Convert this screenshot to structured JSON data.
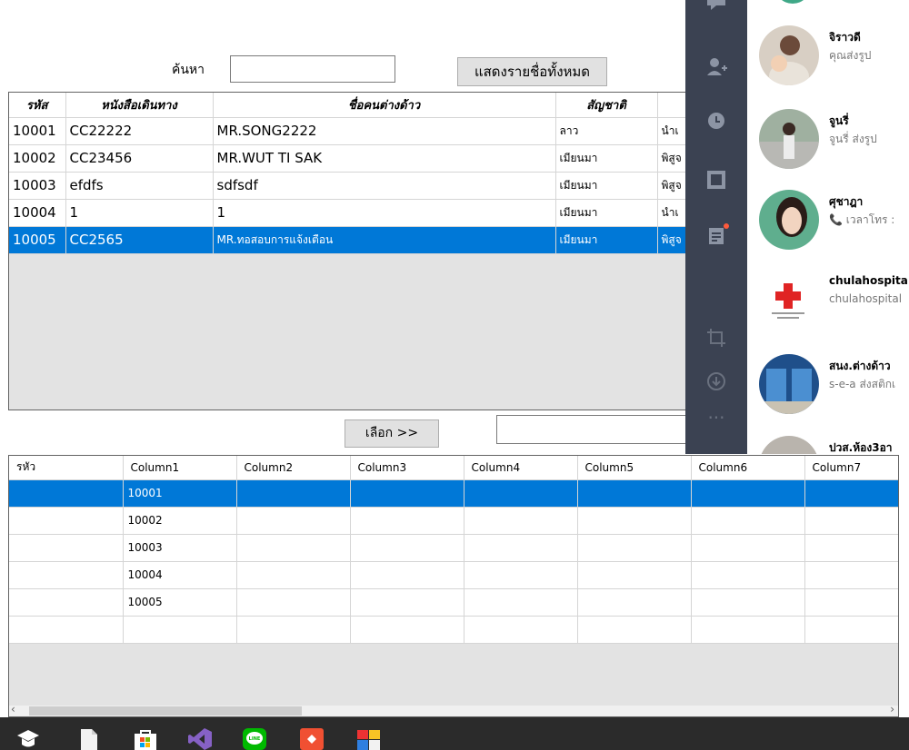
{
  "search": {
    "label": "ค้นหา",
    "value": "",
    "show_all_label": "แสดงรายชื่อทั้งหมด"
  },
  "grid1": {
    "headers": [
      "รหัส",
      "หนังสือเดินทาง",
      "ชื่อคนต่างด้าว",
      "สัญชาติ",
      ""
    ],
    "rows": [
      [
        "10001",
        "CC22222",
        "MR.SONG2222",
        "ลาว",
        "นำเ"
      ],
      [
        "10002",
        "CC23456",
        "MR.WUT TI SAK",
        "เมียนมา",
        "พิสูจ"
      ],
      [
        "10003",
        "efdfs",
        "sdfsdf",
        "เมียนมา",
        "พิสูจ"
      ],
      [
        "10004",
        "1",
        "1",
        "เมียนมา",
        "นำเ"
      ],
      [
        "10005",
        "CC2565",
        "MR.ทอสอบการแจ้งเตือน",
        "เมียนมา",
        "พิสูจ"
      ]
    ],
    "selected_row": 4
  },
  "select_button_label": "เลือก >>",
  "aux_input_value": "",
  "grid2": {
    "headers": [
      "รหัว",
      "Column1",
      "Column2",
      "Column3",
      "Column4",
      "Column5",
      "Column6",
      "Column7"
    ],
    "rows": [
      [
        "",
        "10001",
        "",
        "",
        "",
        "",
        "",
        ""
      ],
      [
        "",
        "10002",
        "",
        "",
        "",
        "",
        "",
        ""
      ],
      [
        "",
        "10003",
        "",
        "",
        "",
        "",
        "",
        ""
      ],
      [
        "",
        "10004",
        "",
        "",
        "",
        "",
        "",
        ""
      ],
      [
        "",
        "10005",
        "",
        "",
        "",
        "",
        "",
        ""
      ],
      [
        "",
        "",
        "",
        "",
        "",
        "",
        "",
        ""
      ]
    ],
    "selected_row": 0
  },
  "line_app": {
    "rail_icons": [
      "chat-icon",
      "add-friend-icon",
      "clock-icon",
      "note-icon",
      "timeline-icon",
      "crop-icon",
      "download-icon",
      "more-icon"
    ],
    "chats": [
      {
        "name": "จิราวดี",
        "message": "คุณส่งรูป"
      },
      {
        "name": "จูนรี่",
        "message": "จูนรี่ ส่งรูป"
      },
      {
        "name": "ศุชาฎา",
        "message": "📞 เวลาโทร : "
      },
      {
        "name": "chulahospita",
        "message": "chulahospital "
      },
      {
        "name": "สนง.ต่างด้าว",
        "message": "s-e-a ส่งสติกเ"
      },
      {
        "name": "ปวส.ห้อง3อา",
        "message": ""
      }
    ]
  },
  "taskbar": {
    "icons": [
      "graduation-cap-icon",
      "file-icon",
      "store-icon",
      "visual-studio-icon",
      "line-icon",
      "git-icon",
      "app-tiles-icon"
    ]
  },
  "colors": {
    "selection": "#0078d7",
    "line_rail": "#3b4252",
    "taskbar": "#2b2b2b"
  }
}
